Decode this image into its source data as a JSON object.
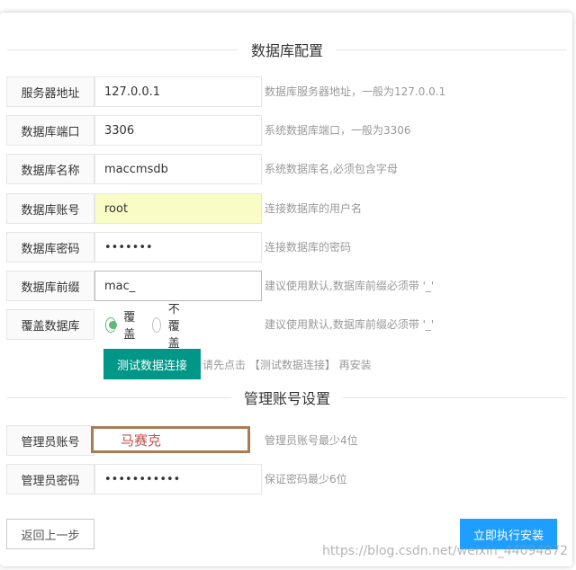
{
  "db_section": {
    "title": "数据库配置"
  },
  "fields": [
    {
      "label": "服务器地址",
      "value": "127.0.0.1",
      "hint": "数据库服务器地址，一般为127.0.0.1"
    },
    {
      "label": "数据库端口",
      "value": "3306",
      "hint": "系统数据库端口，一般为3306"
    },
    {
      "label": "数据库名称",
      "value": "maccmsdb",
      "hint": "系统数据库名,必须包含字母"
    },
    {
      "label": "数据库账号",
      "value": "root",
      "hint": "连接数据库的用户名"
    },
    {
      "label": "数据库密码",
      "value": "•••••••",
      "hint": "连接数据库的密码"
    },
    {
      "label": "数据库前缀",
      "value": "mac_",
      "hint": "建议使用默认,数据库前缀必须带 '_'"
    }
  ],
  "overwrite": {
    "label": "覆盖数据库",
    "options": [
      "覆盖",
      "不覆盖"
    ],
    "selected": "覆盖",
    "hint": "建议使用默认,数据库前缀必须带 '_'"
  },
  "test_button": {
    "label": "测试数据连接",
    "hint": "请先点击 【测试数据连接】 再安装"
  },
  "admin_section": {
    "title": "管理账号设置"
  },
  "admin": {
    "username": {
      "label": "管理员账号",
      "value": "马赛克",
      "hint": "管理员账号最少4位"
    },
    "password": {
      "label": "管理员密码",
      "value": "•••••••••••",
      "hint": "保证密码最少6位"
    }
  },
  "footer": {
    "back_label": "返回上一步",
    "install_label": "立即执行安装",
    "watermark": "https://blog.csdn.net/weixin_44094872"
  },
  "colors": {
    "test_button": "#009688",
    "install_button": "#1e9fff",
    "radio_checked": "#5fb878",
    "autofill": "#fafcc6"
  }
}
